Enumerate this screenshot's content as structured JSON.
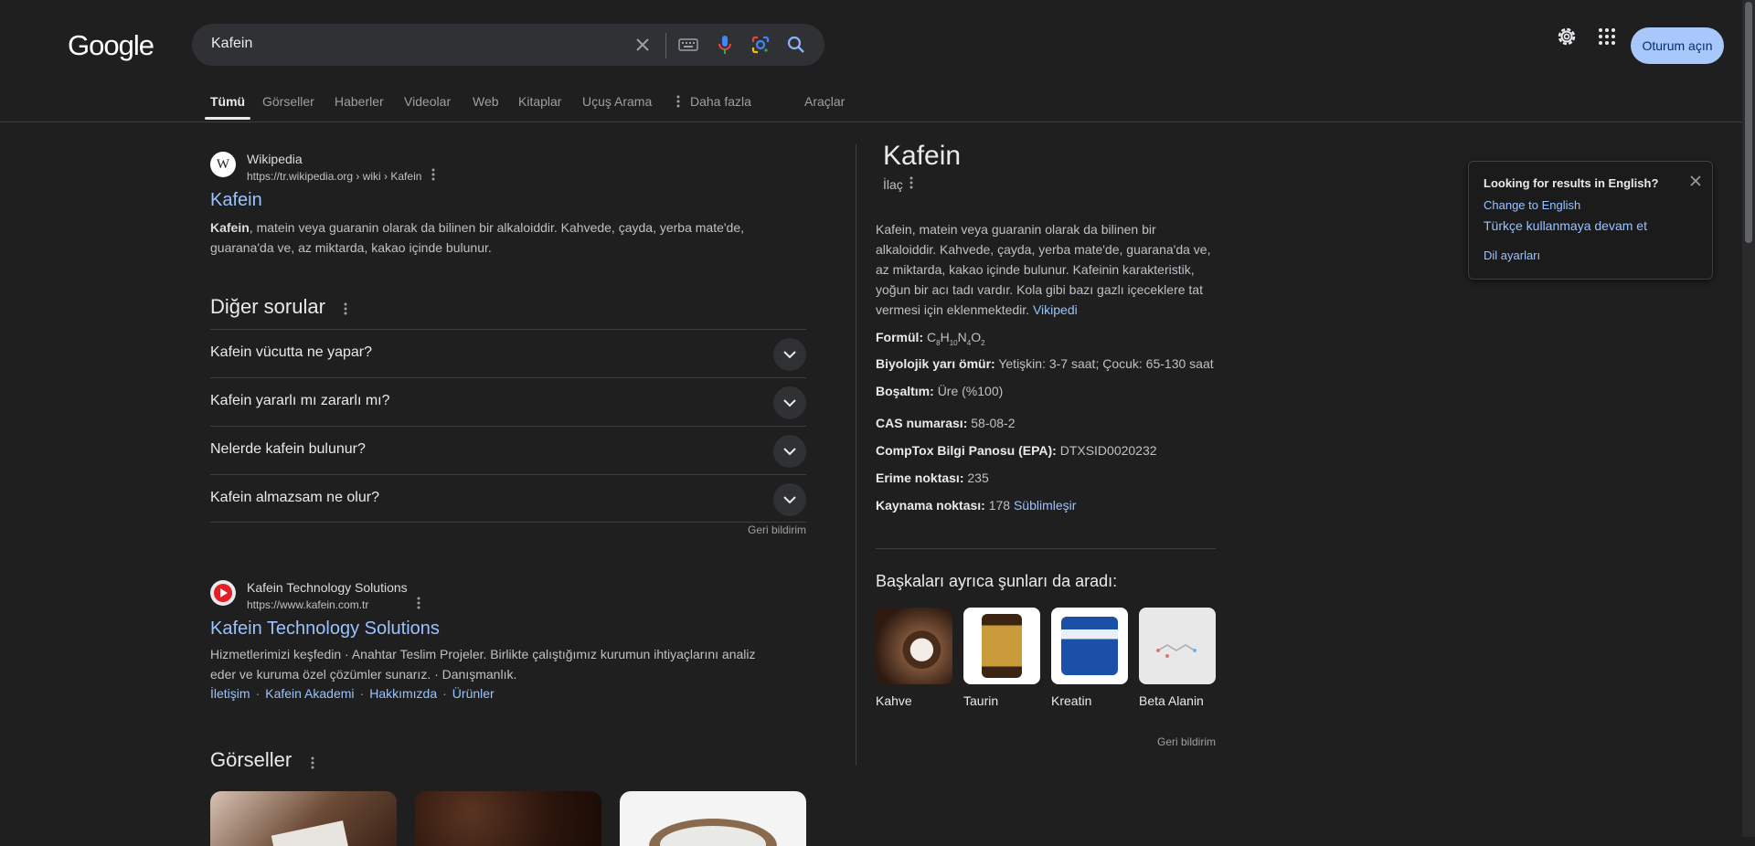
{
  "header": {
    "logo": "Google",
    "search_value": "Kafein",
    "signin_label": "Oturum açın",
    "icons": [
      "clear-icon",
      "keyboard-icon",
      "mic-icon",
      "lens-icon",
      "search-icon",
      "gear-icon",
      "apps-icon"
    ]
  },
  "tabs": [
    {
      "label": "Tümü",
      "active": true
    },
    {
      "label": "Görseller"
    },
    {
      "label": "Haberler"
    },
    {
      "label": "Videolar"
    },
    {
      "label": "Web"
    },
    {
      "label": "Kitaplar"
    },
    {
      "label": "Uçuş Arama"
    },
    {
      "label": "Daha fazla"
    },
    {
      "label": "Araçlar"
    }
  ],
  "result1": {
    "site_name": "Wikipedia",
    "favicon_letter": "W",
    "url": "https://tr.wikipedia.org › wiki › Kafein",
    "title": "Kafein",
    "snippet_bold": "Kafein",
    "snippet_rest": ", matein veya guaranin olarak da bilinen bir alkaloiddir. Kahvede, çayda, yerba mate'de, guarana'da ve, az miktarda, kakao içinde bulunur."
  },
  "paa": {
    "heading": "Diğer sorular",
    "questions": [
      "Kafein vücutta ne yapar?",
      "Kafein yararlı mı zararlı mı?",
      "Nelerde kafein bulunur?",
      "Kafein almazsam ne olur?"
    ],
    "feedback": "Geri bildirim"
  },
  "result2": {
    "site_name": "Kafein Technology Solutions",
    "url": "https://www.kafein.com.tr",
    "title": "Kafein Technology Solutions",
    "snippet": "Hizmetlerimizi keşfedin · Anahtar Teslim Projeler. Birlikte çalıştığımız kurumun ihtiyaçlarını analiz eder ve kuruma özel çözümler sunarız. · Danışmanlık.",
    "sitelinks": [
      "İletişim",
      "Kafein Akademi",
      "Hakkımızda",
      "Ürünler"
    ]
  },
  "images_section": {
    "heading": "Görseller"
  },
  "knowledge_panel": {
    "title": "Kafein",
    "subtitle": "İlaç",
    "description": "Kafein, matein veya guaranin olarak da bilinen bir alkaloiddir. Kahvede, çayda, yerba mate'de, guarana'da ve, az miktarda, kakao içinde bulunur. Kafeinin karakteristik, yoğun bir acı tadı vardır. Kola gibi bazı gazlı içeceklere tat vermesi için eklenmektedir.",
    "description_link": "Vikipedi",
    "facts": {
      "formula_label": "Formül:",
      "formula": {
        "c": "C",
        "c_n": "8",
        "h": "H",
        "h_n": "10",
        "n": "N",
        "n_n": "4",
        "o": "O",
        "o_n": "2"
      },
      "halflife_label": "Biyolojik yarı ömür:",
      "halflife_value": "Yetişkin: 3-7 saat; Çocuk: 65-130 saat",
      "excretion_label": "Boşaltım:",
      "excretion_value": "Üre (%100)",
      "cas_label": "CAS numarası:",
      "cas_value": "58-08-2",
      "comptox_label": "CompTox Bilgi Panosu (EPA):",
      "comptox_value": "DTXSID0020232",
      "melting_label": "Erime noktası:",
      "melting_value": "235",
      "boiling_label": "Kaynama noktası:",
      "boiling_value": "178",
      "boiling_link": "Süblimleşir"
    },
    "also_searched_heading": "Başkaları ayrıca şunları da aradı:",
    "also_searched": [
      "Kahve",
      "Taurin",
      "Kreatin",
      "Beta Alanin"
    ],
    "feedback": "Geri bildirim"
  },
  "lang_popup": {
    "title": "Looking for results in English?",
    "change": "Change to English",
    "keep": "Türkçe kullanmaya devam et",
    "settings": "Dil ayarları"
  }
}
